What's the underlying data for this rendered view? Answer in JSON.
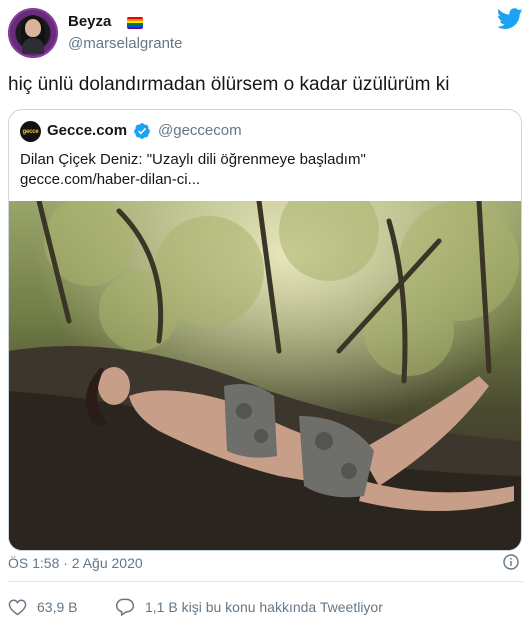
{
  "user": {
    "display_name": "Beyza",
    "handle": "@marselalgrante",
    "flag_colors": [
      "#e40303",
      "#ff8c00",
      "#ffed00",
      "#008026",
      "#004dff",
      "#750787"
    ]
  },
  "tweet": {
    "text": "hiç ünlü dolandırmadan ölürsem o kadar üzülürüm ki",
    "timestamp": "ÖS 1:58 · 2 Ağu 2020"
  },
  "quoted": {
    "avatar_text": "gecce",
    "name": "Gecce.com",
    "handle": "@geccecom",
    "line1": "Dilan Çiçek Deniz: \"Uzaylı dili öğrenmeye başladım\"",
    "line2": "gecce.com/haber-dilan-ci..."
  },
  "actions": {
    "likes": "63,9 B",
    "replies": "1,1 B kişi bu konu hakkında Tweetliyor"
  },
  "colors": {
    "twitter_blue": "#1da1f2",
    "secondary_text": "#657786",
    "border": "#ccd6dd",
    "verified": "#1da1f2"
  }
}
